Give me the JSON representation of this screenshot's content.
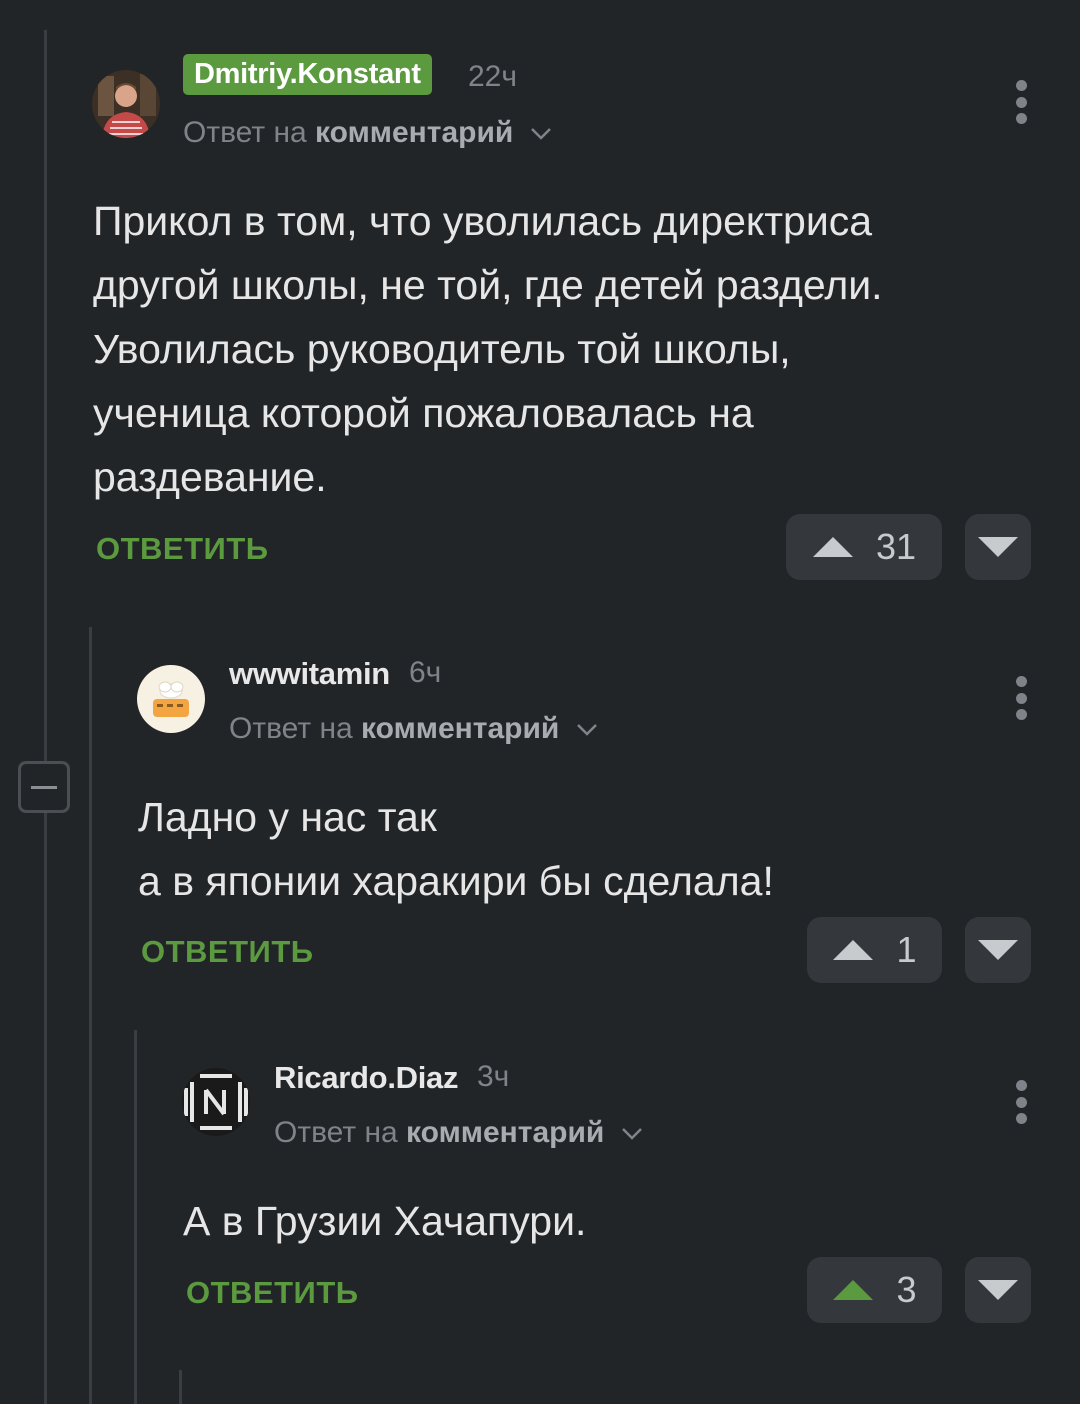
{
  "colors": {
    "background": "#222528",
    "accent_green": "#5c9a3f",
    "muted_text": "#7e8489",
    "button_bg": "#34383c"
  },
  "comments": [
    {
      "username": "Dmitriy.Konstant",
      "time": "22ч",
      "reply_prefix": "Ответ на",
      "reply_target": "комментарий",
      "text": "Прикол в том, что уволилась директриса\nдругой школы, не той, где детей раздели.\nУволилась руководитель той школы,\nученица которой пожаловалась на\nраздевание.",
      "reply_label": "ОТВЕТИТЬ",
      "rating": "31",
      "upvoted": false
    },
    {
      "username": "wwwitamin",
      "time": "6ч",
      "reply_prefix": "Ответ на",
      "reply_target": "комментарий",
      "text": "Ладно у нас так\nа в японии харакири бы сделала!",
      "reply_label": "ОТВЕТИТЬ",
      "rating": "1",
      "upvoted": false
    },
    {
      "username": "Ricardo.Diaz",
      "time": "3ч",
      "reply_prefix": "Ответ на",
      "reply_target": "комментарий",
      "text": "А в Грузии Хачапури.",
      "reply_label": "ОТВЕТИТЬ",
      "rating": "3",
      "upvoted": true
    }
  ]
}
